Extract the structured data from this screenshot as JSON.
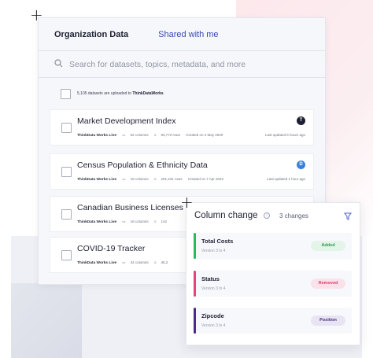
{
  "tabs": [
    {
      "label": "Organization Data",
      "active": true
    },
    {
      "label": "Shared with me",
      "active": false
    }
  ],
  "search": {
    "placeholder": "Search for datasets, topics, metadata, and more"
  },
  "upload": {
    "count_text": "5,105 datasets are uploaded to ",
    "org": "ThinkDataWorks"
  },
  "datasets": [
    {
      "title": "Market Development Index",
      "source": "ThinkData Works Live",
      "columns": "52 columns",
      "rows": "93,772 rows",
      "created": "Created on 4 May 2020",
      "updated": "Last updated 6 hours ago",
      "avatar": "T",
      "avatar_color": "#1d2033"
    },
    {
      "title": "Census Population & Ethnicity Data",
      "source": "ThinkData Works Live",
      "columns": "19 columns",
      "rows": "201,231 rows",
      "created": "Created on 7 Apr 2022",
      "updated": "Last updated 1 hour ago",
      "avatar": "D",
      "avatar_color": "#3d7fe0"
    },
    {
      "title": "Canadian Business Licenses",
      "source": "ThinkData Works Live",
      "columns": "16 columns",
      "rows": "142",
      "created": "",
      "updated": "",
      "avatar": "",
      "avatar_color": ""
    },
    {
      "title": "COVID-19 Tracker",
      "source": "ThinkData Works Live",
      "columns": "34 columns",
      "rows": "45,2",
      "created": "",
      "updated": "",
      "avatar": "",
      "avatar_color": ""
    }
  ],
  "column_change": {
    "title": "Column change",
    "count": "3 changes",
    "changes": [
      {
        "name": "Total Costs",
        "version": "Version 3 to 4",
        "badge": "Added",
        "bar_color": "#2db85c",
        "badge_bg": "#e3f4e8",
        "badge_color": "#2c9a52"
      },
      {
        "name": "Status",
        "version": "Version 3 to 4",
        "badge": "Removed",
        "bar_color": "#e0457b",
        "badge_bg": "#fbe2ea",
        "badge_color": "#d6406f"
      },
      {
        "name": "Zipcode",
        "version": "Version 3 to 4",
        "badge": "Position",
        "bar_color": "#4a2a8a",
        "badge_bg": "#e9e4f3",
        "badge_color": "#4a3380"
      }
    ]
  }
}
